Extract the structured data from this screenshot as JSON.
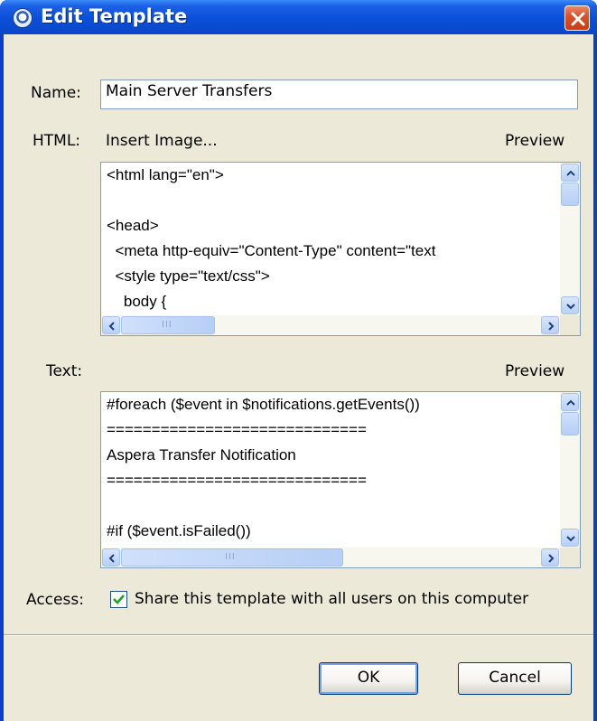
{
  "window": {
    "title": "Edit Template"
  },
  "name_field": {
    "label": "Name:",
    "value": "Main Server Transfers"
  },
  "html_section": {
    "label": "HTML:",
    "insert_image_link": "Insert Image...",
    "preview_link": "Preview",
    "lines": [
      "<html lang=\"en\">",
      "",
      "<head>",
      "  <meta http-equiv=\"Content-Type\" content=\"text",
      "  <style type=\"text/css\">",
      "    body {"
    ]
  },
  "text_section": {
    "label": "Text:",
    "preview_link": "Preview",
    "lines": [
      "#foreach ($event in $notifications.getEvents())",
      "=============================",
      "Aspera Transfer Notification",
      "=============================",
      "",
      "#if ($event.isFailed())"
    ]
  },
  "access": {
    "label": "Access:",
    "checkbox_checked": true,
    "checkbox_label": "Share this template with all users on this computer"
  },
  "buttons": {
    "ok": "OK",
    "cancel": "Cancel"
  },
  "colors": {
    "titlebar": "#0a4fd8",
    "dialog_bg": "#ece9d8",
    "close": "#d8532b",
    "check": "#21a121"
  }
}
